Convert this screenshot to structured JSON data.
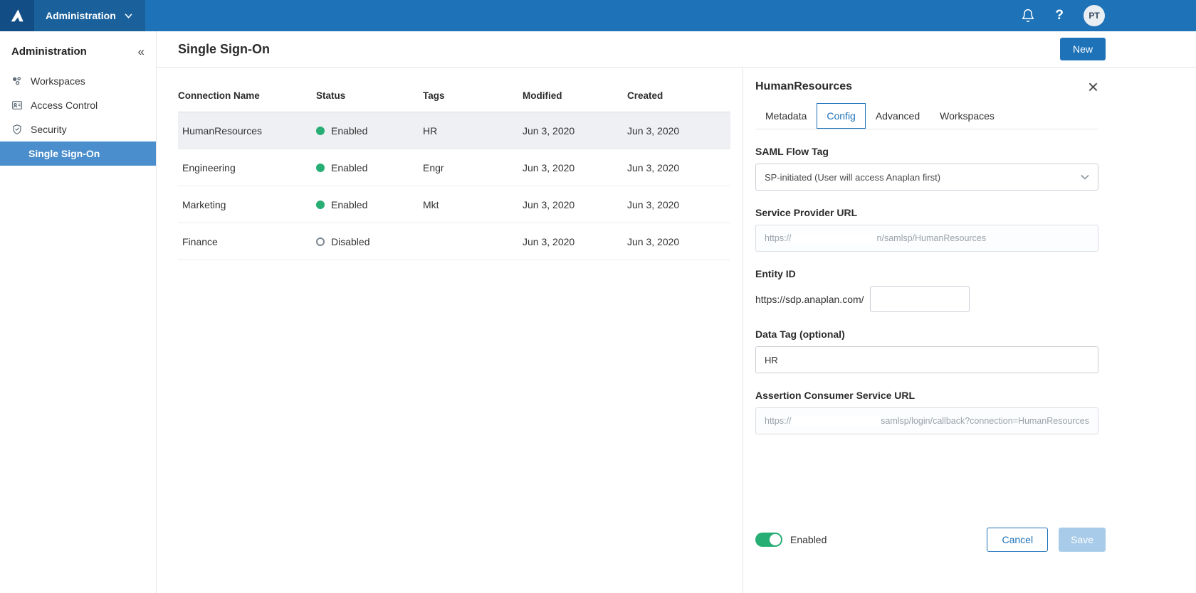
{
  "topbar": {
    "app_menu_label": "Administration",
    "avatar_initials": "PT"
  },
  "sidebar": {
    "title": "Administration",
    "collapse_glyph": "«",
    "items": [
      {
        "label": "Workspaces"
      },
      {
        "label": "Access Control"
      },
      {
        "label": "Security"
      }
    ],
    "subitem": {
      "label": "Single Sign-On"
    }
  },
  "main": {
    "title": "Single Sign-On",
    "new_button": "New",
    "table": {
      "headers": [
        "Connection Name",
        "Status",
        "Tags",
        "Modified",
        "Created"
      ],
      "rows": [
        {
          "name": "HumanResources",
          "status": "Enabled",
          "tags": "HR",
          "modified": "Jun 3, 2020",
          "created": "Jun 3, 2020"
        },
        {
          "name": "Engineering",
          "status": "Enabled",
          "tags": "Engr",
          "modified": "Jun 3, 2020",
          "created": "Jun 3, 2020"
        },
        {
          "name": "Marketing",
          "status": "Enabled",
          "tags": "Mkt",
          "modified": "Jun 3, 2020",
          "created": "Jun 3, 2020"
        },
        {
          "name": "Finance",
          "status": "Disabled",
          "tags": "",
          "modified": "Jun 3, 2020",
          "created": "Jun 3, 2020"
        }
      ]
    }
  },
  "panel": {
    "title": "HumanResources",
    "close_glyph": "×",
    "tabs": [
      "Metadata",
      "Config",
      "Advanced",
      "Workspaces"
    ],
    "active_tab": "Config",
    "fields": {
      "saml_flow_tag": {
        "label": "SAML Flow Tag",
        "value": "SP-initiated (User will access Anaplan first)"
      },
      "service_provider_url": {
        "label": "Service Provider URL",
        "visible_prefix": "https://",
        "visible_suffix": "n/samlsp/HumanResources"
      },
      "entity_id": {
        "label": "Entity ID",
        "prefix_text": "https://sdp.anaplan.com/",
        "value": ""
      },
      "data_tag": {
        "label": "Data Tag (optional)",
        "value": "HR"
      },
      "acs_url": {
        "label": "Assertion Consumer Service URL",
        "visible_prefix": "https://",
        "visible_suffix": "samlsp/login/callback?connection=HumanResources"
      }
    },
    "footer": {
      "toggle_label": "Enabled",
      "cancel_button": "Cancel",
      "save_button": "Save"
    }
  },
  "colors": {
    "topbar_blue": "#1e72b8",
    "selected_nav_blue": "#4a8ecd",
    "accent_blue": "#1e72b8",
    "status_green": "#27ae74",
    "disabled_save_blue": "#a7cbe8"
  }
}
